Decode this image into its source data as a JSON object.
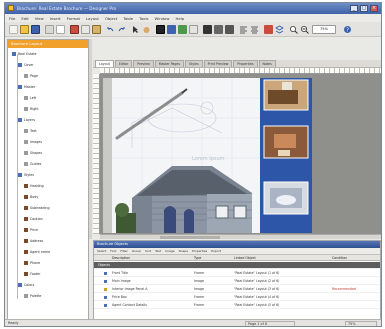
{
  "window": {
    "title": "Brochure: Real Estate Brochure — Designer Pro",
    "min": "_",
    "max": "□",
    "close": "×"
  },
  "menu": [
    "File",
    "Edit",
    "View",
    "Insert",
    "Format",
    "Layout",
    "Object",
    "Table",
    "Tools",
    "Window",
    "Help"
  ],
  "toolbar": {
    "zoom_value": "75%"
  },
  "tree": {
    "header": "Brochure Layout",
    "items": [
      {
        "label": "Real Estate",
        "color": "#4a6fb5",
        "indent": 0
      },
      {
        "label": "Cover",
        "color": "#4a6fb5",
        "indent": 1
      },
      {
        "label": "Page",
        "color": "#9a9a9a",
        "indent": 2
      },
      {
        "label": "Master",
        "color": "#4a6fb5",
        "indent": 1
      },
      {
        "label": "Left",
        "color": "#9a9a9a",
        "indent": 2
      },
      {
        "label": "Right",
        "color": "#9a9a9a",
        "indent": 2
      },
      {
        "label": "Layers",
        "color": "#4a6fb5",
        "indent": 1
      },
      {
        "label": "Text",
        "color": "#9a9a9a",
        "indent": 2
      },
      {
        "label": "Images",
        "color": "#9a9a9a",
        "indent": 2
      },
      {
        "label": "Shapes",
        "color": "#9a9a9a",
        "indent": 2
      },
      {
        "label": "Guides",
        "color": "#9a9a9a",
        "indent": 2
      },
      {
        "label": "Styles",
        "color": "#4a6fb5",
        "indent": 1
      },
      {
        "label": "Heading",
        "color": "#7b4a2a",
        "indent": 2
      },
      {
        "label": "Body",
        "color": "#7b4a2a",
        "indent": 2
      },
      {
        "label": "Subheading",
        "color": "#7b4a2a",
        "indent": 2
      },
      {
        "label": "Caption",
        "color": "#7b4a2a",
        "indent": 2
      },
      {
        "label": "Price",
        "color": "#7b4a2a",
        "indent": 2
      },
      {
        "label": "Address",
        "color": "#7b4a2a",
        "indent": 2
      },
      {
        "label": "Agent name",
        "color": "#7b4a2a",
        "indent": 2
      },
      {
        "label": "Phone",
        "color": "#7b4a2a",
        "indent": 2
      },
      {
        "label": "Footer",
        "color": "#7b4a2a",
        "indent": 2
      },
      {
        "label": "Colors",
        "color": "#4a6fb5",
        "indent": 1
      },
      {
        "label": "Palette",
        "color": "#9a9a9a",
        "indent": 2
      }
    ]
  },
  "doc_tabs": [
    "Layout",
    "Editor",
    "Preview",
    "Master Pages",
    "Styles",
    "Print Preview",
    "Properties",
    "Notes"
  ],
  "page": {
    "brand_text": "Lorem Ipsum"
  },
  "bottom": {
    "header": "Brochure Objects",
    "toolbar": [
      "Select",
      "Find",
      "Filter",
      "Group",
      "Sort",
      "Text",
      "Image",
      "Shape",
      "Properties",
      "Export"
    ],
    "columns": [
      "",
      "Description",
      "Type",
      "Linked Object",
      "Condition"
    ],
    "group_label": "Objects",
    "rows": [
      {
        "desc": "Front Title",
        "type": "Frame",
        "linked": "\"Real Estate\" Layout (1 of 6)",
        "status": "",
        "color": "#4a6fb5"
      },
      {
        "desc": "Main Image",
        "type": "Image",
        "linked": "\"Real Estate\" Layout (2 of 6)",
        "status": "",
        "color": "#4a6fb5"
      },
      {
        "desc": "Interior Image Panel A",
        "type": "Image",
        "linked": "\"Real Estate\" Layout (3 of 6)",
        "status": "Recommended",
        "color": "#c9a227"
      },
      {
        "desc": "Price Box",
        "type": "Frame",
        "linked": "\"Real Estate\" Layout (4 of 6)",
        "status": "",
        "color": "#4a6fb5"
      },
      {
        "desc": "Agent Contact Details",
        "type": "Frame",
        "linked": "\"Real Estate\" Layout (5 of 6)",
        "status": "",
        "color": "#4a6fb5"
      }
    ]
  },
  "status": {
    "left": "Ready",
    "page": "Page 1 of 6",
    "right": "75%"
  },
  "colors": {
    "title_bar": "#3f61a6",
    "tree_header": "#f0a02b",
    "blue_panel": "#2e56a8",
    "canvas": "#8f8f8c"
  }
}
